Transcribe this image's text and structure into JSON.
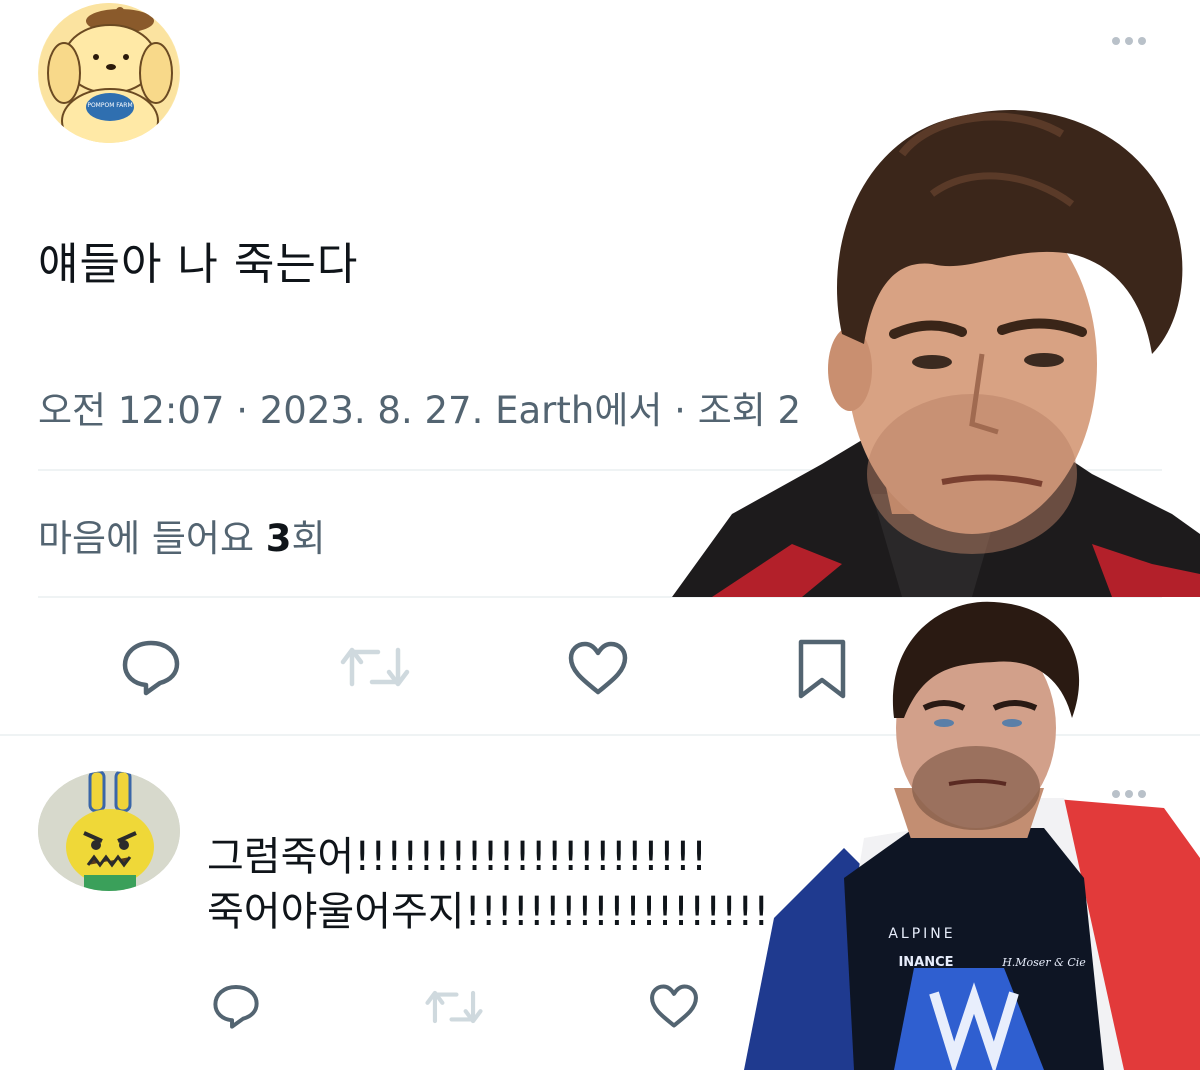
{
  "tweet": {
    "avatar_text": "POMPOM FARM",
    "text": "얘들아 나 죽는다",
    "meta": "오전 12:07 · 2023. 8. 27. Earth에서 · 조회 2",
    "likes_prefix": "마음에 들어요 ",
    "likes_count": "3",
    "likes_suffix": "회"
  },
  "reply": {
    "line1": "그럼죽어!!!!!!!!!!!!!!!!!!!!!!",
    "line2": "죽어야울어주지!!!!!!!!!!!!!!!!!!!"
  },
  "photo2": {
    "shirt_brand": "ALPINE",
    "sponsor": "BINANCE",
    "sponsor_visible": "INANCE",
    "sponsor2": "H.Moser & Cie"
  },
  "icons": {
    "reply": "reply-icon",
    "retweet": "retweet-icon",
    "like": "heart-icon",
    "bookmark": "bookmark-icon",
    "more": "more-icon"
  },
  "colors": {
    "text": "#0f1419",
    "secondary": "#536471",
    "icon": "#536471",
    "icon_faded": "#cfd9de",
    "divider": "#eff3f4"
  }
}
